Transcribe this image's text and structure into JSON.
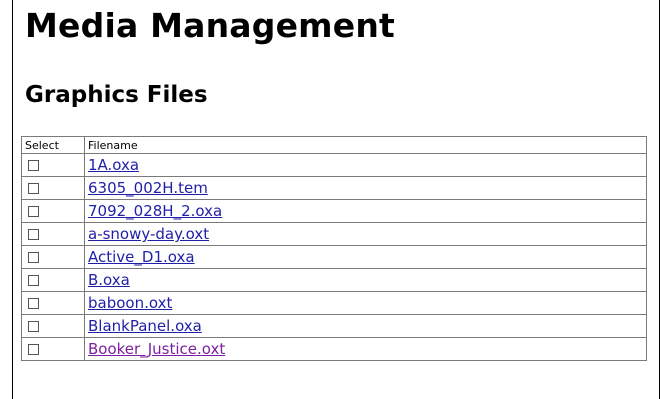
{
  "page": {
    "title": "Media Management",
    "section_title": "Graphics Files"
  },
  "table": {
    "headers": {
      "select": "Select",
      "filename": "Filename"
    },
    "rows": [
      {
        "filename": "1A.oxa",
        "checked": false,
        "visited": false
      },
      {
        "filename": "6305_002H.tem",
        "checked": false,
        "visited": false
      },
      {
        "filename": "7092_028H_2.oxa",
        "checked": false,
        "visited": false
      },
      {
        "filename": "a-snowy-day.oxt",
        "checked": false,
        "visited": false
      },
      {
        "filename": "Active_D1.oxa",
        "checked": false,
        "visited": false
      },
      {
        "filename": "B.oxa",
        "checked": false,
        "visited": false
      },
      {
        "filename": "baboon.oxt",
        "checked": false,
        "visited": false
      },
      {
        "filename": "BlankPanel.oxa",
        "checked": false,
        "visited": false
      },
      {
        "filename": "Booker_Justice.oxt",
        "checked": false,
        "visited": true
      }
    ]
  },
  "colors": {
    "link": "#1f1fa8",
    "visited_link": "#7d1f9e",
    "border": "#7a7a7a"
  }
}
